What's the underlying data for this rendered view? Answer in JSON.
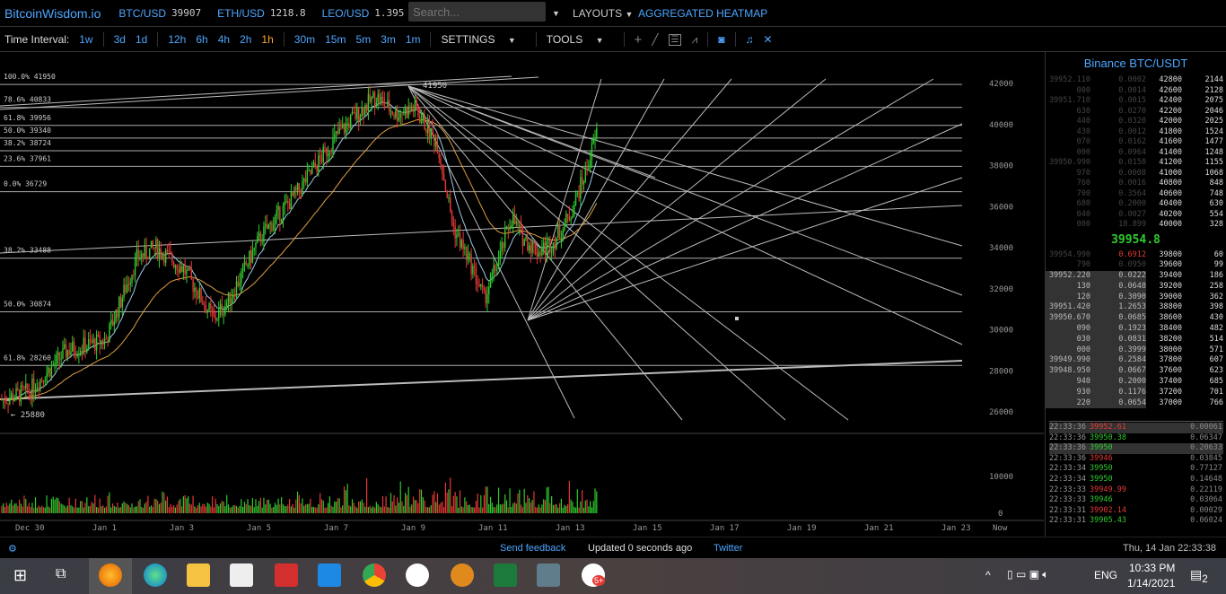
{
  "header": {
    "brand": "BitcoinWisdom.io",
    "tickers": [
      {
        "pair": "BTC/USD",
        "price": "39907"
      },
      {
        "pair": "ETH/USD",
        "price": "1218.8"
      },
      {
        "pair": "LEO/USD",
        "price": "1.395"
      }
    ],
    "search_placeholder": "Search...",
    "layouts": "LAYOUTS",
    "heatmap": "AGGREGATED HEATMAP"
  },
  "toolbar": {
    "label": "Time Interval:",
    "intervals": [
      "1w",
      "3d",
      "1d",
      "12h",
      "6h",
      "4h",
      "2h",
      "1h",
      "30m",
      "15m",
      "5m",
      "3m",
      "1m"
    ],
    "active": "1h",
    "settings": "SETTINGS",
    "tools": "TOOLS"
  },
  "chart_data": {
    "type": "candlestick",
    "yaxis": [
      "42000",
      "40000",
      "38000",
      "36000",
      "34000",
      "32000",
      "30000",
      "28000",
      "26000"
    ],
    "volume_axis": [
      "10000",
      "0"
    ],
    "xaxis": [
      "Dec 30",
      "Jan 1",
      "Jan 3",
      "Jan 5",
      "Jan 7",
      "Jan 9",
      "Jan 11",
      "Jan 13",
      "Jan 15",
      "Jan 17",
      "Jan 19",
      "Jan 21",
      "Jan 23",
      "Now"
    ],
    "fib_levels": [
      {
        "label": "100.0% 41950",
        "price": 41950
      },
      {
        "label": "78.6% 40833",
        "price": 40833
      },
      {
        "label": "61.8% 39956",
        "price": 39956
      },
      {
        "label": "50.0% 39340",
        "price": 39340
      },
      {
        "label": "38.2% 38724",
        "price": 38724
      },
      {
        "label": "23.6% 37961",
        "price": 37961
      },
      {
        "label": "0.0% 36729",
        "price": 36729
      },
      {
        "label": "38.2% 33488",
        "price": 33488
      },
      {
        "label": "50.0% 30874",
        "price": 30874
      },
      {
        "label": "61.8% 28260",
        "price": 28260
      }
    ],
    "high_label": "41950",
    "low_label": "← 25880",
    "price_path": [
      [
        -0.7,
        26600
      ],
      [
        0,
        27000
      ],
      [
        1,
        29000
      ],
      [
        2,
        29500
      ],
      [
        2.8,
        33500
      ],
      [
        3.3,
        34000
      ],
      [
        4,
        33000
      ],
      [
        4.8,
        30500
      ],
      [
        5.2,
        31500
      ],
      [
        6,
        34500
      ],
      [
        7,
        36800
      ],
      [
        8,
        39500
      ],
      [
        8.5,
        40500
      ],
      [
        9,
        41400
      ],
      [
        9.5,
        40500
      ],
      [
        10,
        40800
      ],
      [
        10.6,
        39000
      ],
      [
        11,
        35000
      ],
      [
        11.5,
        33000
      ],
      [
        11.8,
        31500
      ],
      [
        12.2,
        33500
      ],
      [
        12.5,
        35500
      ],
      [
        12.8,
        34500
      ],
      [
        13.2,
        33800
      ],
      [
        13.6,
        34300
      ],
      [
        14,
        35500
      ],
      [
        14.4,
        37500
      ],
      [
        14.75,
        39800
      ]
    ]
  },
  "orderbook": {
    "title": "Binance BTC/USDT",
    "asks": [
      [
        "39952.110",
        "0.0002",
        "42800",
        "2144"
      ],
      [
        "000",
        "0.0014",
        "42600",
        "2128"
      ],
      [
        "39951.710",
        "0.0015",
        "42400",
        "2075"
      ],
      [
        "630",
        "0.0270",
        "42200",
        "2046"
      ],
      [
        "440",
        "0.0320",
        "42000",
        "2025"
      ],
      [
        "430",
        "0.0012",
        "41800",
        "1524"
      ],
      [
        "070",
        "0.0162",
        "41600",
        "1477"
      ],
      [
        "000",
        "0.0964",
        "41400",
        "1248"
      ],
      [
        "39950.990",
        "0.0150",
        "41200",
        "1155"
      ],
      [
        "970",
        "0.0008",
        "41000",
        "1068"
      ],
      [
        "760",
        "0.0016",
        "40800",
        "848"
      ],
      [
        "700",
        "0.3564",
        "40600",
        "748"
      ],
      [
        "680",
        "0.2000",
        "40400",
        "630"
      ],
      [
        "040",
        "0.0027",
        "40200",
        "554"
      ],
      [
        "000",
        "18.899",
        "40000",
        "328"
      ]
    ],
    "mid": "39954.8",
    "bids": [
      [
        "39954.990",
        "0.6912",
        "39800",
        "60"
      ],
      [
        "790",
        "0.0950",
        "39600",
        "99"
      ],
      [
        "39952.220",
        "0.0222",
        "39400",
        "186"
      ],
      [
        "130",
        "0.0648",
        "39200",
        "258"
      ],
      [
        "120",
        "0.3090",
        "39000",
        "362"
      ],
      [
        "39951.420",
        "1.2653",
        "38800",
        "398"
      ],
      [
        "39950.670",
        "0.0685",
        "38600",
        "430"
      ],
      [
        "090",
        "0.1923",
        "38400",
        "482"
      ],
      [
        "030",
        "0.0831",
        "38200",
        "514"
      ],
      [
        "000",
        "0.3999",
        "38000",
        "571"
      ],
      [
        "39949.990",
        "0.2584",
        "37800",
        "607"
      ],
      [
        "39948.950",
        "0.0667",
        "37600",
        "623"
      ],
      [
        "940",
        "0.2000",
        "37400",
        "685"
      ],
      [
        "930",
        "0.1176",
        "37200",
        "701"
      ],
      [
        "220",
        "0.0654",
        "37000",
        "766"
      ]
    ],
    "trades": [
      [
        "22:33:36",
        "39952.61",
        "0.00061",
        "sell"
      ],
      [
        "22:33:36",
        "39950.38",
        "0.06347",
        "buy"
      ],
      [
        "22:33:36",
        "39950",
        "0.20633",
        "buy"
      ],
      [
        "22:33:36",
        "39946",
        "0.03845",
        "sell"
      ],
      [
        "22:33:34",
        "39950",
        "0.77127",
        "buy"
      ],
      [
        "22:33:34",
        "39950",
        "0.14648",
        "buy"
      ],
      [
        "22:33:33",
        "39949.99",
        "0.22119",
        "sell"
      ],
      [
        "22:33:33",
        "39946",
        "0.03064",
        "buy"
      ],
      [
        "22:33:31",
        "39902.14",
        "0.00029",
        "sell"
      ],
      [
        "22:33:31",
        "39905.43",
        "0.06024",
        "buy"
      ]
    ]
  },
  "status": {
    "feedback": "Send feedback",
    "updated": "Updated 0 seconds ago",
    "twitter": "Twitter",
    "datetime": "Thu, 14 Jan 22:33:38"
  },
  "taskbar": {
    "lang": "ENG",
    "time": "10:33 PM",
    "date": "1/14/2021",
    "notif_count": "2",
    "badge": "5+"
  },
  "colors": {
    "up": "#2ecc2e",
    "down": "#e53935",
    "accent": "#4da6ff"
  }
}
